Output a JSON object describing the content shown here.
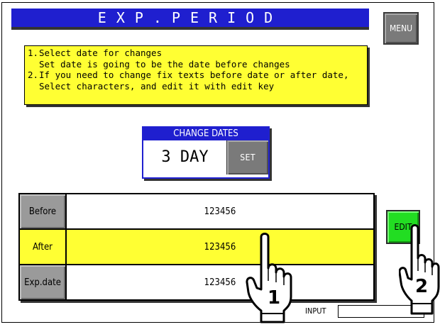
{
  "title": "EXP.PERIOD",
  "menu_label": "MENU",
  "instructions": [
    {
      "num": "1.",
      "text": "Select date for changes"
    },
    {
      "num": "",
      "text": "Set date is going to be the date before changes"
    },
    {
      "num": "2.",
      "text": "If you need to change fix texts before date or after date,"
    },
    {
      "num": "",
      "text": "Select characters, and edit it with edit key"
    }
  ],
  "change_dates": {
    "header": "CHANGE DATES",
    "value": "3 DAY",
    "set_label": "SET"
  },
  "rows": [
    {
      "label": "Before",
      "value": "123456"
    },
    {
      "label": "After",
      "value": "123456"
    },
    {
      "label": "Exp.date",
      "value": "123456"
    }
  ],
  "edit_label": "EDIT",
  "input_label": "INPUT",
  "callouts": {
    "hand_1": "1",
    "hand_2": "2"
  },
  "colors": {
    "title_blue": "#1f1fcf",
    "highlight_yellow": "#ffff33",
    "edit_green": "#22dd22",
    "button_gray": "#7a7a7a"
  }
}
